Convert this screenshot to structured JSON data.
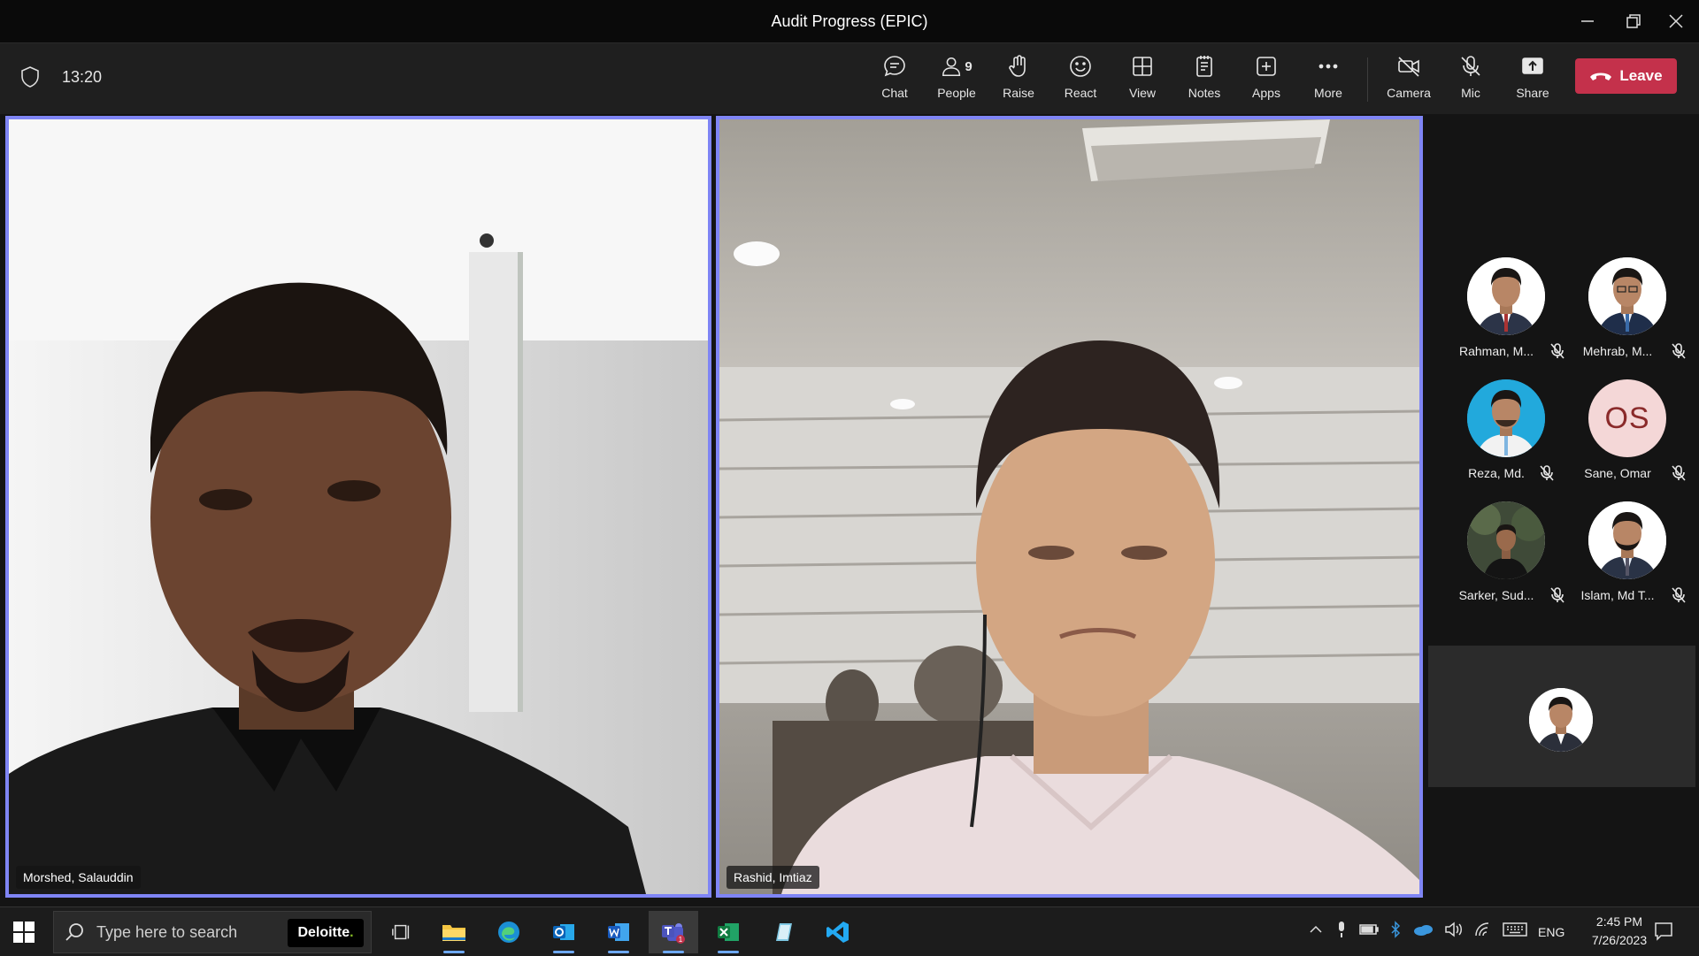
{
  "window": {
    "title": "Audit Progress (EPIC)"
  },
  "toolbar": {
    "timer": "13:20",
    "chat": "Chat",
    "people": "People",
    "people_count": "9",
    "raise": "Raise",
    "react": "React",
    "view": "View",
    "notes": "Notes",
    "apps": "Apps",
    "more": "More",
    "camera": "Camera",
    "mic": "Mic",
    "share": "Share",
    "leave": "Leave"
  },
  "videos": [
    {
      "name": "Morshed, Salauddin"
    },
    {
      "name": "Rashid, Imtiaz"
    }
  ],
  "participants": [
    {
      "name": "Rahman, M...",
      "muted": true
    },
    {
      "name": "Mehrab, M...",
      "muted": true
    },
    {
      "name": "Reza, Md.",
      "muted": true
    },
    {
      "name": "Sane, Omar",
      "initials": "OS",
      "muted": true
    },
    {
      "name": "Sarker, Sud...",
      "muted": true
    },
    {
      "name": "Islam, Md T...",
      "muted": true
    }
  ],
  "taskbar": {
    "search_placeholder": "Type here to search",
    "search_brand": "Deloitte",
    "teams_badge": "1",
    "language": "ENG",
    "time": "2:45 PM",
    "date": "7/26/2023"
  },
  "colors": {
    "active_speaker_border": "#7f85f5",
    "leave_button": "#c4314b",
    "titlebar_bg": "#0a0a0a",
    "toolbar_bg": "#1f1f1f"
  }
}
